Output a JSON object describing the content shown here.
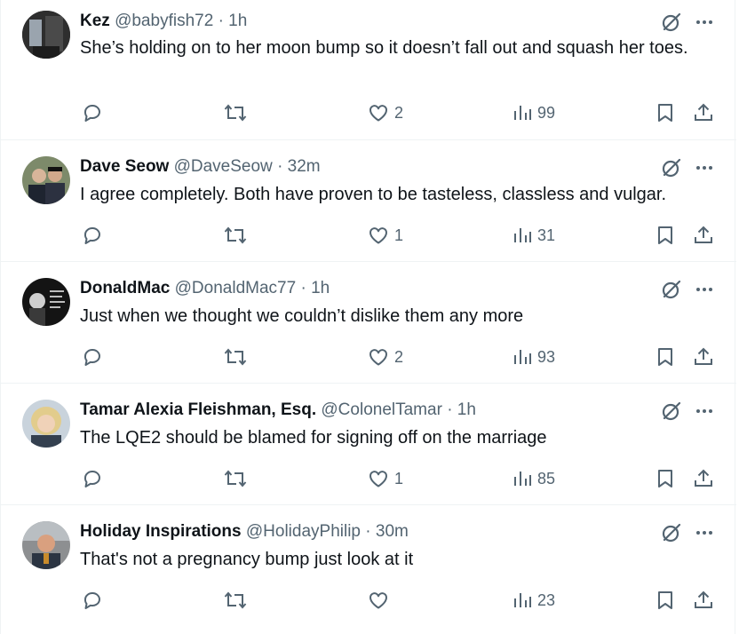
{
  "tweets": [
    {
      "name": "Kez",
      "handle": "@babyfish72",
      "dot": "·",
      "time": "1h",
      "text": "She’s holding on to her moon bump so it doesn’t fall out and squash her toes.",
      "likes": "2",
      "views": "99"
    },
    {
      "name": "Dave Seow",
      "handle": "@DaveSeow",
      "dot": "·",
      "time": "32m",
      "text": "I agree completely. Both have proven to be tasteless, classless and vulgar.",
      "likes": "1",
      "views": "31"
    },
    {
      "name": "DonaldMac",
      "handle": "@DonaldMac77",
      "dot": "·",
      "time": "1h",
      "text": "Just when we thought we couldn’t dislike them any more",
      "likes": "2",
      "views": "93"
    },
    {
      "name": "Tamar Alexia Fleishman, Esq.",
      "handle": "@ColonelTamar",
      "dot": "·",
      "time": "1h",
      "text": "The LQE2 should be blamed for signing off on the marriage",
      "likes": "1",
      "views": "85"
    },
    {
      "name": "Holiday Inspirations",
      "handle": "@HolidayPhilip",
      "dot": "·",
      "time": "30m",
      "text": "That's not a pregnancy bump just look at it",
      "likes": "",
      "views": "23"
    }
  ],
  "colors": {
    "text": "#0f1419",
    "secondary": "#536471",
    "border": "#eff3f4"
  }
}
